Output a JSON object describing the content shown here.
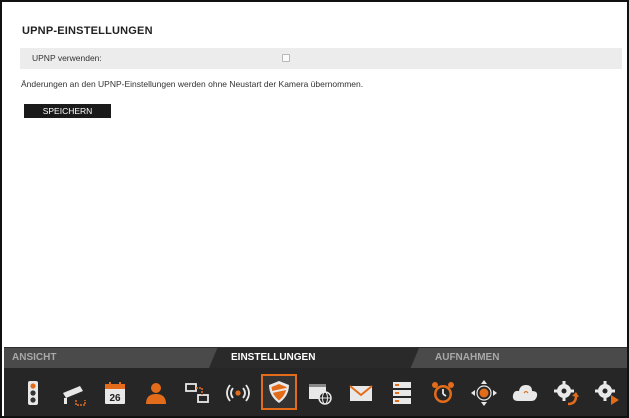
{
  "settings": {
    "title": "UPNP-EINSTELLUNGEN",
    "upnp_label": "UPNP verwenden:",
    "upnp_enabled": false,
    "info_text": "Änderungen an den UPNP-Einstellungen werden ohne Neustart der Kamera übernommen.",
    "save_label": "SPEICHERN"
  },
  "tabs": [
    {
      "label": "ANSICHT",
      "active": false
    },
    {
      "label": "EINSTELLUNGEN",
      "active": true
    },
    {
      "label": "AUFNAHMEN",
      "active": false
    }
  ],
  "toolbar": {
    "calendar_day": "26",
    "accent_color": "#e36c1b",
    "icons": [
      "traffic-light-icon",
      "camera-icon",
      "calendar-icon",
      "user-icon",
      "network-icon",
      "wireless-icon",
      "shield-icon",
      "web-icon",
      "mail-icon",
      "server-icon",
      "alarm-clock-icon",
      "ptz-icon",
      "cloud-icon",
      "gear-reset-icon",
      "gear-play-icon"
    ],
    "active_icon": "shield-icon"
  }
}
